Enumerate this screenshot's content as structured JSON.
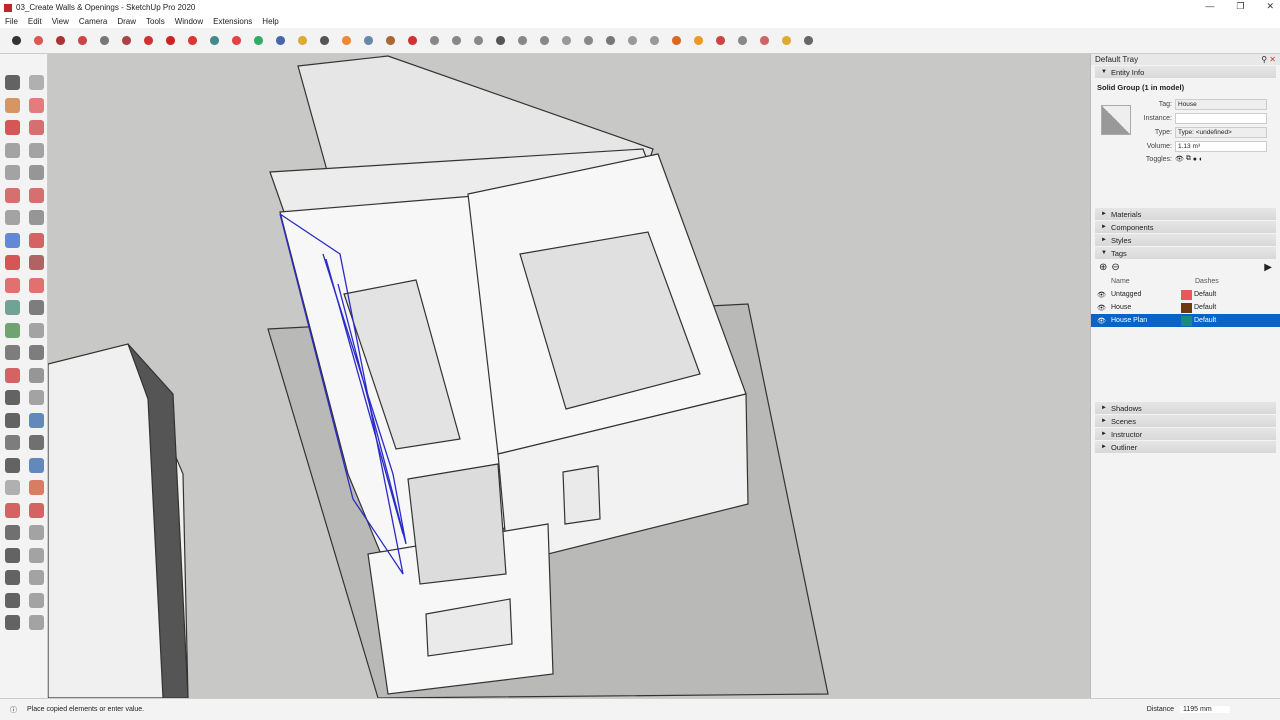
{
  "window": {
    "title": "03_Create Walls & Openings - SketchUp Pro 2020",
    "minimize": "—",
    "restore": "❐",
    "close": "✕"
  },
  "menu": [
    "File",
    "Edit",
    "View",
    "Camera",
    "Draw",
    "Tools",
    "Window",
    "Extensions",
    "Help"
  ],
  "tray": {
    "title": "Default Tray",
    "pin": "⚲",
    "close": "✕",
    "entity_info": {
      "header": "Entity Info",
      "heading": "Solid Group (1 in model)",
      "tag_label": "Tag:",
      "tag_value": "House",
      "instance_label": "Instance:",
      "instance_value": "",
      "type_label": "Type:",
      "type_value": "Type: <undefined>",
      "volume_label": "Volume:",
      "volume_value": "1.13 m³",
      "toggles_label": "Toggles:"
    },
    "panels": [
      "Materials",
      "Components",
      "Styles"
    ],
    "tags": {
      "header": "Tags",
      "col_name": "Name",
      "col_dashes": "Dashes",
      "rows": [
        {
          "name": "Untagged",
          "color": "#e8595a",
          "dashes": "Default"
        },
        {
          "name": "House",
          "color": "#6b3a12",
          "dashes": "Default"
        },
        {
          "name": "House Plan",
          "color": "#1a8a7a",
          "dashes": "Default",
          "selected": true
        }
      ]
    },
    "bottom_panels": [
      "Shadows",
      "Scenes",
      "Instructor",
      "Outliner"
    ]
  },
  "status": {
    "message": "Place copied elements or enter value.",
    "measure_label": "Distance",
    "measure_value": "1195 mm"
  },
  "colors": {
    "selection": "#0a64c8",
    "viewport": "#c8c8c6"
  }
}
